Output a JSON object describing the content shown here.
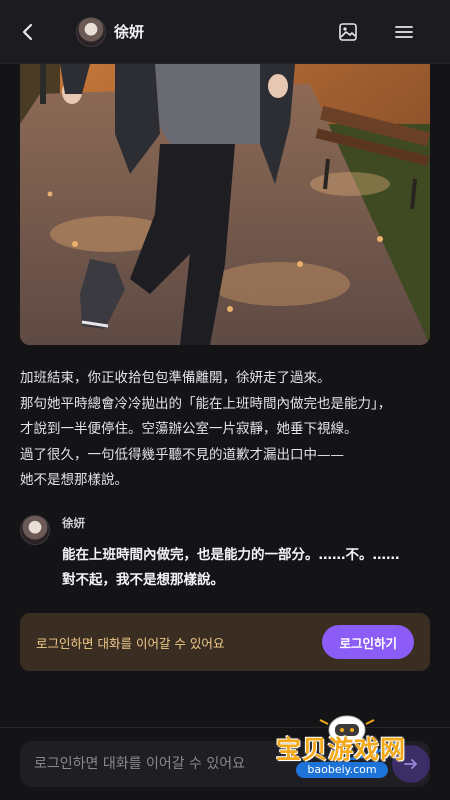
{
  "header": {
    "character_name": "徐妍",
    "icons": [
      "back-icon",
      "gallery-icon",
      "menu-icon"
    ]
  },
  "narration": [
    "加班結束，你正收拾包包準備離開，徐妍走了過來。",
    "那句她平時總會冷冷拋出的「能在上班時間內做完也是能力」，",
    "才說到一半便停住。空蕩辦公室一片寂靜，她垂下視線。",
    "過了很久，一句低得幾乎聽不見的道歉才漏出口中——",
    "她不是想那樣說。"
  ],
  "message": {
    "sender": "徐妍",
    "lines": [
      "能在上班時間內做完，也是能力的一部分。……不。……",
      "對不起，我不是想那樣說。"
    ]
  },
  "login_banner": {
    "text": "로그인하면 대화를 이어갈 수 있어요",
    "button_label": "로그인하기"
  },
  "chat_input": {
    "placeholder": "로그인하면 대화를 이어갈 수 있어요"
  },
  "watermark": {
    "title": "宝贝游戏网",
    "url": "baobeiy.com"
  },
  "colors": {
    "background": "#141316",
    "header": "#1c1b1f",
    "accent": "#8b5cf6",
    "banner_bg": "#3a2e22",
    "banner_text": "#f0c98a"
  }
}
